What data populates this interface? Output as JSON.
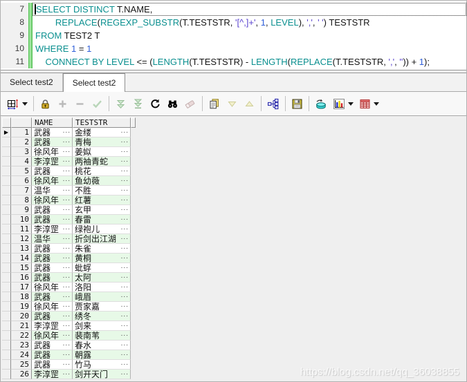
{
  "editor": {
    "lines": [
      {
        "num": "7",
        "focused": true,
        "segments": [
          {
            "c": "kw",
            "t": "SELECT DISTINCT"
          },
          {
            "c": "txt",
            "t": " T.NAME,"
          }
        ]
      },
      {
        "num": "8",
        "segments": [
          {
            "c": "txt",
            "t": "        "
          },
          {
            "c": "kw",
            "t": "REPLACE"
          },
          {
            "c": "txt",
            "t": "("
          },
          {
            "c": "kw",
            "t": "REGEXP_SUBSTR"
          },
          {
            "c": "txt",
            "t": "(T.TESTSTR, "
          },
          {
            "c": "str",
            "t": "'[^,]+'"
          },
          {
            "c": "txt",
            "t": ", "
          },
          {
            "c": "num",
            "t": "1"
          },
          {
            "c": "txt",
            "t": ", "
          },
          {
            "c": "kw",
            "t": "LEVEL"
          },
          {
            "c": "txt",
            "t": "), "
          },
          {
            "c": "str",
            "t": "','"
          },
          {
            "c": "txt",
            "t": ", "
          },
          {
            "c": "str",
            "t": "' '"
          },
          {
            "c": "txt",
            "t": ") TESTSTR"
          }
        ]
      },
      {
        "num": "9",
        "segments": [
          {
            "c": "kw",
            "t": "FROM"
          },
          {
            "c": "txt",
            "t": " TEST2 T"
          }
        ]
      },
      {
        "num": "10",
        "segments": [
          {
            "c": "kw",
            "t": "WHERE"
          },
          {
            "c": "txt",
            "t": " "
          },
          {
            "c": "num",
            "t": "1"
          },
          {
            "c": "txt",
            "t": " = "
          },
          {
            "c": "num",
            "t": "1"
          }
        ]
      },
      {
        "num": "11",
        "segments": [
          {
            "c": "txt",
            "t": "    "
          },
          {
            "c": "kw",
            "t": "CONNECT BY LEVEL"
          },
          {
            "c": "txt",
            "t": " <= ("
          },
          {
            "c": "kw",
            "t": "LENGTH"
          },
          {
            "c": "txt",
            "t": "(T.TESTSTR) - "
          },
          {
            "c": "kw",
            "t": "LENGTH"
          },
          {
            "c": "txt",
            "t": "("
          },
          {
            "c": "kw",
            "t": "REPLACE"
          },
          {
            "c": "txt",
            "t": "(T.TESTSTR, "
          },
          {
            "c": "str",
            "t": "','"
          },
          {
            "c": "txt",
            "t": ", "
          },
          {
            "c": "str",
            "t": "''"
          },
          {
            "c": "txt",
            "t": ")) + "
          },
          {
            "c": "num",
            "t": "1"
          },
          {
            "c": "txt",
            "t": ");"
          }
        ]
      }
    ]
  },
  "tabs": [
    {
      "label": "Select test2",
      "active": false
    },
    {
      "label": "Select test2",
      "active": true
    }
  ],
  "toolbar": {
    "items": [
      {
        "name": "grid-mode",
        "enabled": true,
        "dropdown": true
      },
      {
        "sep": true
      },
      {
        "name": "lock",
        "enabled": true
      },
      {
        "name": "add-row",
        "enabled": false
      },
      {
        "name": "delete-row",
        "enabled": false
      },
      {
        "name": "post-changes",
        "enabled": false
      },
      {
        "sep": true
      },
      {
        "name": "fetch-next",
        "enabled": false
      },
      {
        "name": "fetch-all",
        "enabled": false
      },
      {
        "name": "refresh",
        "enabled": true
      },
      {
        "name": "find",
        "enabled": true
      },
      {
        "name": "erase",
        "enabled": false
      },
      {
        "sep": true
      },
      {
        "name": "copy-results",
        "enabled": true
      },
      {
        "name": "move-down",
        "enabled": false
      },
      {
        "name": "move-up",
        "enabled": false
      },
      {
        "sep": true
      },
      {
        "name": "tree-view",
        "enabled": true
      },
      {
        "sep": true
      },
      {
        "name": "save",
        "enabled": true
      },
      {
        "sep": true
      },
      {
        "name": "export-data",
        "enabled": true
      },
      {
        "name": "chart",
        "enabled": true,
        "dropdown": true
      },
      {
        "name": "report",
        "enabled": true,
        "dropdown": true
      }
    ]
  },
  "grid": {
    "columns": [
      "NAME",
      "TESTSTR"
    ],
    "current_row": 1,
    "rows": [
      {
        "n": 1,
        "name": "武器",
        "teststr": "金缕"
      },
      {
        "n": 2,
        "name": "武器",
        "teststr": "青梅"
      },
      {
        "n": 3,
        "name": "徐风年",
        "teststr": "姜姒"
      },
      {
        "n": 4,
        "name": "李淳罡",
        "teststr": "两袖青蛇"
      },
      {
        "n": 5,
        "name": "武器",
        "teststr": "桃花"
      },
      {
        "n": 6,
        "name": "徐风年",
        "teststr": "鱼幼薇"
      },
      {
        "n": 7,
        "name": "温华",
        "teststr": "不胜"
      },
      {
        "n": 8,
        "name": "徐风年",
        "teststr": "红薯"
      },
      {
        "n": 9,
        "name": "武器",
        "teststr": "玄甲"
      },
      {
        "n": 10,
        "name": "武器",
        "teststr": "春雷"
      },
      {
        "n": 11,
        "name": "李淳罡",
        "teststr": "绿袍儿"
      },
      {
        "n": 12,
        "name": "温华",
        "teststr": "折剑出江湖"
      },
      {
        "n": 13,
        "name": "武器",
        "teststr": "朱雀"
      },
      {
        "n": 14,
        "name": "武器",
        "teststr": "黄桐"
      },
      {
        "n": 15,
        "name": "武器",
        "teststr": "蚍蜉"
      },
      {
        "n": 16,
        "name": "武器",
        "teststr": "太阿"
      },
      {
        "n": 17,
        "name": "徐风年",
        "teststr": "洛阳"
      },
      {
        "n": 18,
        "name": "武器",
        "teststr": "峨眉"
      },
      {
        "n": 19,
        "name": "徐风年",
        "teststr": "贾家嘉"
      },
      {
        "n": 20,
        "name": "武器",
        "teststr": "绣冬"
      },
      {
        "n": 21,
        "name": "李淳罡",
        "teststr": "剑来"
      },
      {
        "n": 22,
        "name": "徐风年",
        "teststr": "裴南苇"
      },
      {
        "n": 23,
        "name": "武器",
        "teststr": "春水"
      },
      {
        "n": 24,
        "name": "武器",
        "teststr": "朝露"
      },
      {
        "n": 25,
        "name": "武器",
        "teststr": "竹马"
      },
      {
        "n": 26,
        "name": "李淳罡",
        "teststr": "剑开天门"
      }
    ]
  },
  "watermark": "https://blog.csdn.net/qq_36038855",
  "colors": {
    "keyword": "#0a8f8f",
    "string": "#5a43d0",
    "number": "#2f5fd9",
    "row_stripe": "#e7f9e7",
    "change_bar": "#49bd49",
    "grid_header_bg": "#f0f0f0"
  }
}
